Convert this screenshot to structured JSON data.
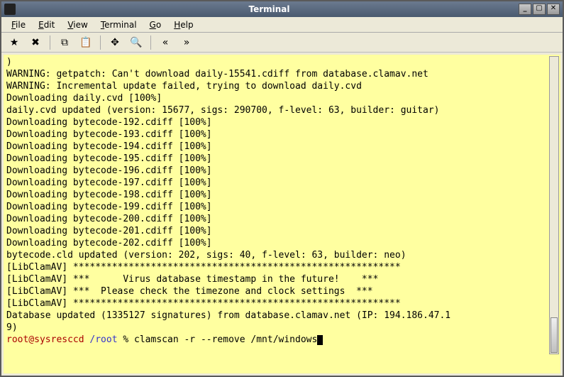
{
  "window": {
    "title": "Terminal"
  },
  "menubar": {
    "file": "File",
    "edit": "Edit",
    "view": "View",
    "terminal": "Terminal",
    "go": "Go",
    "help": "Help"
  },
  "terminal": {
    "lines": [
      ")",
      "WARNING: getpatch: Can't download daily-15541.cdiff from database.clamav.net",
      "WARNING: Incremental update failed, trying to download daily.cvd",
      "Downloading daily.cvd [100%]",
      "daily.cvd updated (version: 15677, sigs: 290700, f-level: 63, builder: guitar)",
      "Downloading bytecode-192.cdiff [100%]",
      "Downloading bytecode-193.cdiff [100%]",
      "Downloading bytecode-194.cdiff [100%]",
      "Downloading bytecode-195.cdiff [100%]",
      "Downloading bytecode-196.cdiff [100%]",
      "Downloading bytecode-197.cdiff [100%]",
      "Downloading bytecode-198.cdiff [100%]",
      "Downloading bytecode-199.cdiff [100%]",
      "Downloading bytecode-200.cdiff [100%]",
      "Downloading bytecode-201.cdiff [100%]",
      "Downloading bytecode-202.cdiff [100%]",
      "bytecode.cld updated (version: 202, sigs: 40, f-level: 63, builder: neo)",
      "[LibClamAV] ***********************************************************",
      "[LibClamAV] ***      Virus database timestamp in the future!    ***",
      "[LibClamAV] ***  Please check the timezone and clock settings  ***",
      "[LibClamAV] ***********************************************************",
      "Database updated (1335127 signatures) from database.clamav.net (IP: 194.186.47.1",
      "9)"
    ],
    "prompt_user": "root@sysresccd",
    "prompt_path": "/root",
    "prompt_symbol": "%",
    "command": "clamscan -r --remove /mnt/windows"
  },
  "icons": {
    "new_tab": "★",
    "close_tab": "✖",
    "copy": "⧉",
    "paste": "📋",
    "fullscreen": "✥",
    "zoom": "🔍",
    "back": "«",
    "forward": "»"
  }
}
